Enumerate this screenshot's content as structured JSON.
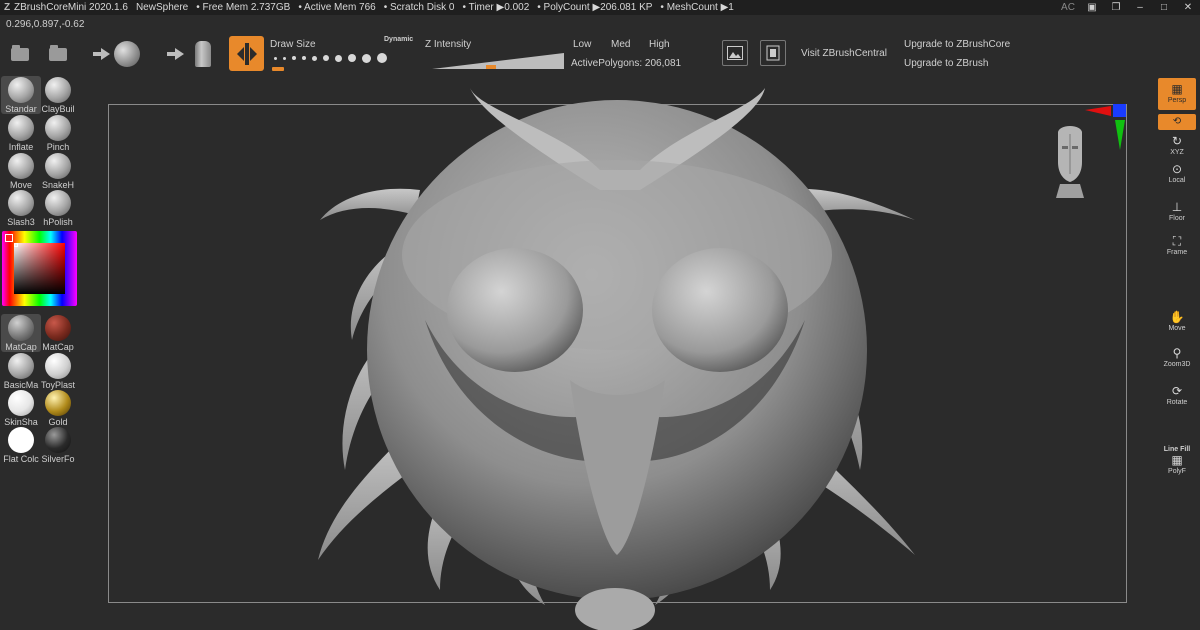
{
  "titlebar": {
    "app": "ZBrushCoreMini 2020.1.6",
    "document": "NewSphere",
    "free_mem": "• Free Mem 2.737GB",
    "active_mem": "• Active Mem 766",
    "scratch": "• Scratch Disk 0",
    "timer": "• Timer ▶0.002",
    "polycount": "• PolyCount ▶206.081 KP",
    "meshcount": "• MeshCount ▶1",
    "right_text": "AC"
  },
  "coords": "0.296,0.897,-0.62",
  "shelf": {
    "draw_size_label": "Draw Size",
    "dynamic_label": "Dynamic",
    "z_intensity_label": "Z Intensity",
    "low": "Low",
    "med": "Med",
    "high": "High",
    "active_polygons": "ActivePolygons: 206,081",
    "visit": "Visit ZBrushCentral",
    "upgrade_core": "Upgrade to ZBrushCore",
    "upgrade_zbrush": "Upgrade to ZBrush"
  },
  "brushes": [
    {
      "label": "Standar"
    },
    {
      "label": "ClayBuil"
    },
    {
      "label": "Inflate"
    },
    {
      "label": "Pinch"
    },
    {
      "label": "Move"
    },
    {
      "label": "SnakeH"
    },
    {
      "label": "Slash3"
    },
    {
      "label": "hPolish"
    }
  ],
  "materials": [
    {
      "label": "MatCap"
    },
    {
      "label": "MatCap"
    },
    {
      "label": "BasicMa"
    },
    {
      "label": "ToyPlast"
    },
    {
      "label": "SkinSha"
    },
    {
      "label": "Gold"
    },
    {
      "label": "Flat Colc"
    },
    {
      "label": "SilverFo"
    }
  ],
  "rightbar": {
    "persp": "Persp",
    "xyz": "XYZ",
    "local": "Local",
    "floor": "Floor",
    "frame": "Frame",
    "move": "Move",
    "zoom3d": "Zoom3D",
    "rotate": "Rotate",
    "linefill": "Line Fill",
    "polyf": "PolyF"
  },
  "colors": {
    "accent": "#e8892b",
    "background": "#2b2b2b",
    "titlebar": "#1f1f1f"
  }
}
